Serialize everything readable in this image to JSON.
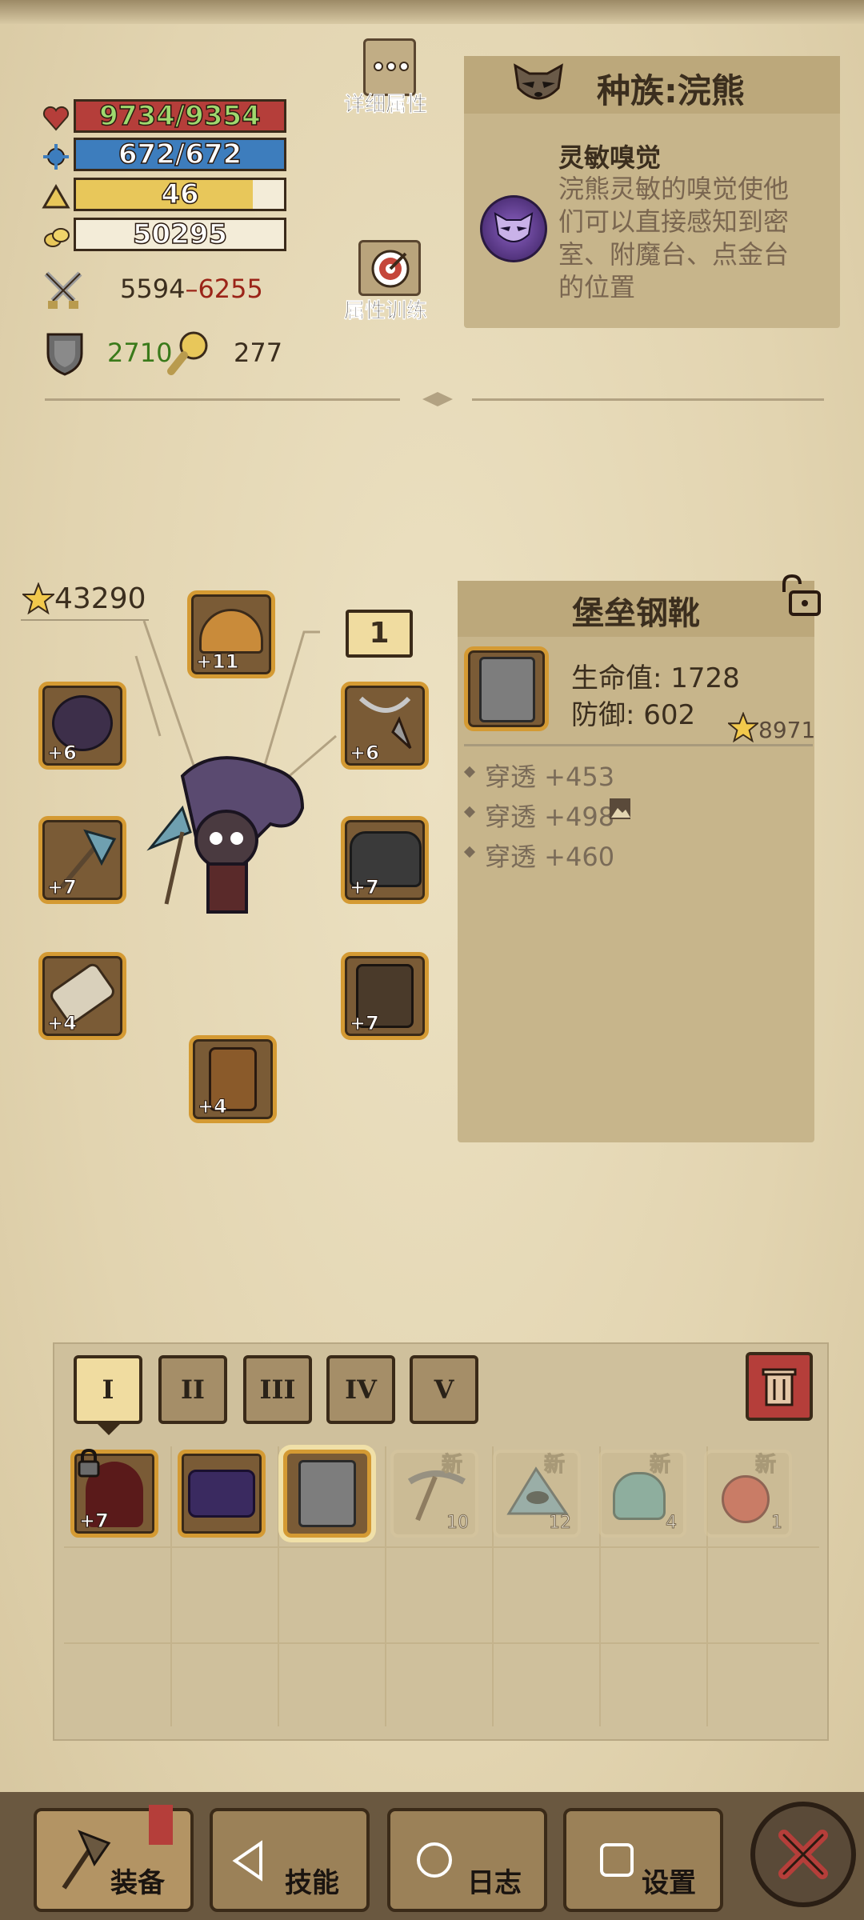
{
  "stats": {
    "hp": "9734/9354",
    "hp_fill": 1.0,
    "mana": "672/672",
    "mana_fill": 1.0,
    "level": "46",
    "level_fill": 0.85,
    "gold": "50295",
    "attack_min": "5594",
    "attack_dash": "–",
    "attack_max": "6255",
    "defense": "2710",
    "crit": "277"
  },
  "buttons": {
    "details_label": "详细属性",
    "training_label": "属性训练"
  },
  "race": {
    "title": "种族:浣熊",
    "skill_name": "灵敏嗅觉",
    "skill_desc_1": "浣熊灵敏的嗅觉使他",
    "skill_desc_2": "们可以直接感知到密",
    "skill_desc_3": "室、附魔台、点金台",
    "skill_desc_4": "的位置"
  },
  "equipment": {
    "total_score": "43290",
    "level_badge": "1",
    "slots": {
      "helmet": "+11",
      "shield_left": "+6",
      "weapon": "+7",
      "gauntlet": "+4",
      "boots": "+4",
      "amulet": "+6",
      "chest": "+7",
      "legs": "+7"
    }
  },
  "item": {
    "name": "堡垒钢靴",
    "stat1": "生命值: 1728",
    "stat2": "防御: 602",
    "score": "8971",
    "effects": [
      "穿透 +453",
      "穿透 +498",
      "穿透 +460"
    ]
  },
  "bag": {
    "tabs": [
      "I",
      "II",
      "III",
      "IV",
      "V"
    ],
    "items": [
      {
        "badge": "+7",
        "locked": true
      },
      {
        "badge": ""
      },
      {
        "badge": ""
      },
      {
        "badge": "10",
        "new": "新"
      },
      {
        "badge": "12",
        "new": "新"
      },
      {
        "badge": "4",
        "new": "新"
      },
      {
        "badge": "1",
        "new": "新"
      }
    ]
  },
  "nav": {
    "equip": "装备",
    "skills": "技能",
    "log": "日志",
    "settings": "设置"
  },
  "colors": {
    "hp": "#b53e3a",
    "mana": "#3d7dbd",
    "level": "#e8c75a",
    "attack_max": "#9b2418",
    "defense": "#3a7a1a"
  }
}
